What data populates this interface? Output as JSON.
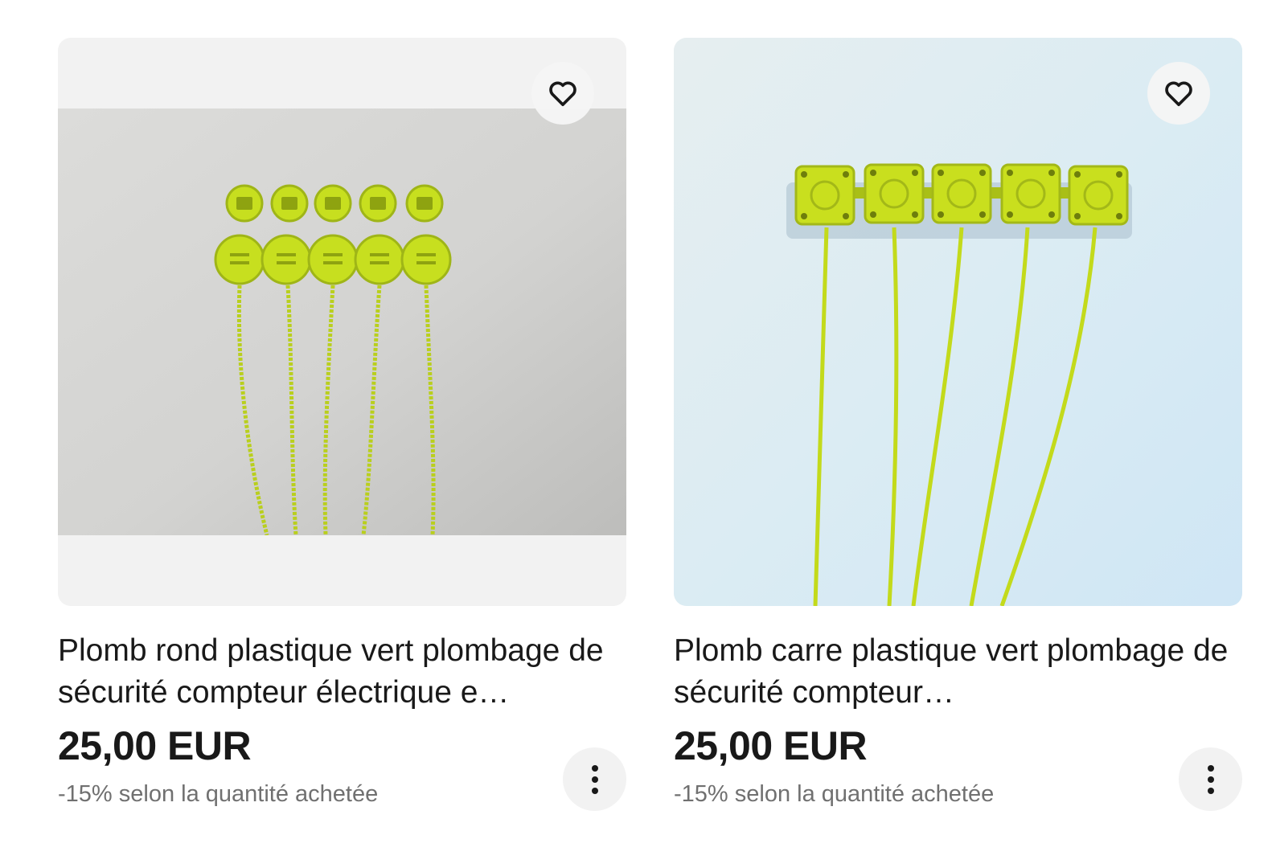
{
  "listings": [
    {
      "title": "Plomb rond plastique vert plombage de sécurité compteur électrique e…",
      "price": "25,00 EUR",
      "discount": "-15% selon la quantité achetée",
      "image_icon": "round-green-plastic-seals-photo",
      "watch_icon": "heart-outline-icon",
      "more_icon": "vertical-ellipsis-icon"
    },
    {
      "title": "Plomb carre plastique vert plombage de sécurité compteur…",
      "price": "25,00 EUR",
      "discount": "-15% selon la quantité achetée",
      "image_icon": "square-green-plastic-seals-photo",
      "watch_icon": "heart-outline-icon",
      "more_icon": "vertical-ellipsis-icon"
    }
  ],
  "colors": {
    "text": "#191919",
    "secondary_text": "#707070",
    "image_bg": "#f2f2f2",
    "seal_green": "#c9e01e"
  }
}
